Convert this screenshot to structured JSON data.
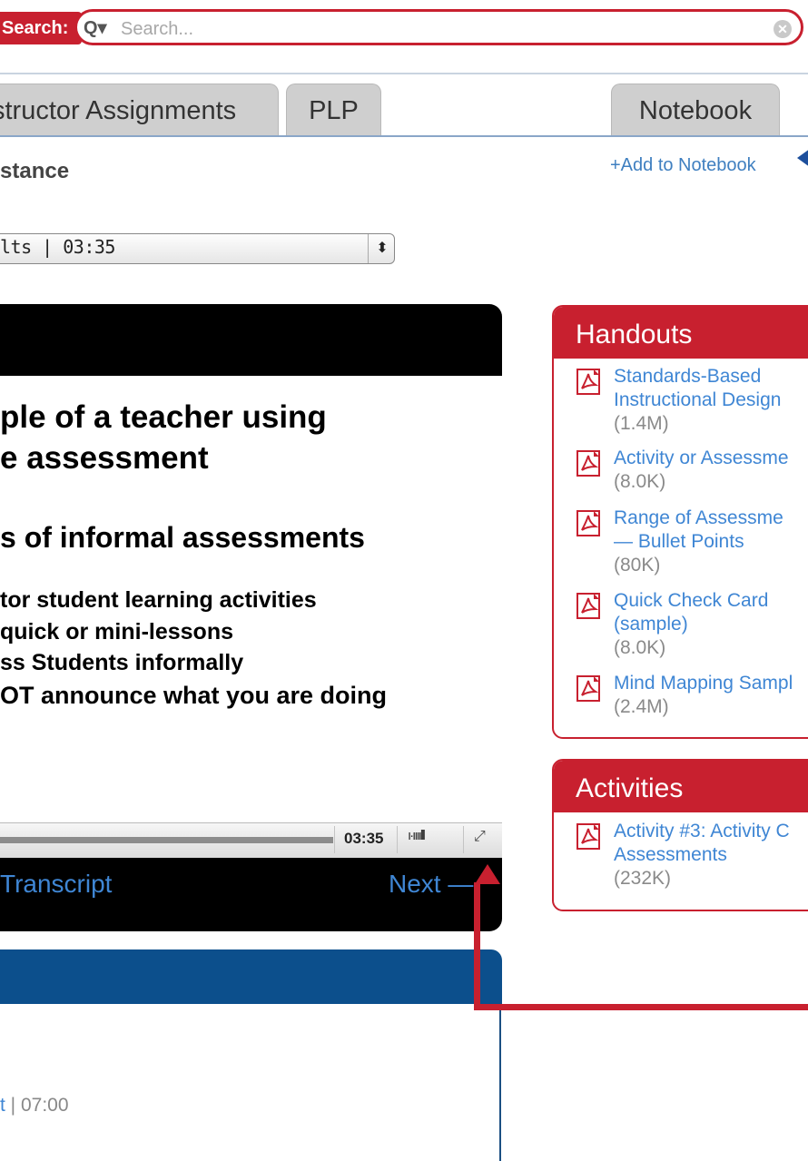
{
  "search": {
    "label": "Search:",
    "placeholder": "Search...",
    "magnifier": "Q▾",
    "clear": "✕"
  },
  "tabs": [
    {
      "label": "structor Assignments"
    },
    {
      "label": "PLP"
    },
    {
      "label": "Notebook"
    }
  ],
  "heading": "stance",
  "add_to_notebook": "+Add to Notebook",
  "video_select": {
    "value": "lts  | 03:35",
    "arrows": "⬍"
  },
  "slide": {
    "lines": [
      "ple of a teacher using",
      "e assessment",
      "s of informal assessments",
      "tor student learning activities",
      "quick or mini-lessons",
      "ss Students informally",
      "OT announce what you are doing"
    ]
  },
  "player": {
    "time": "03:35",
    "volume_glyph": "ı·ıııılll",
    "fullscreen_glyph": "⤢",
    "transcript_label": "Transcript",
    "next_label": "Next —"
  },
  "next_item": {
    "link": "t",
    "duration": " | 07:00"
  },
  "handouts": {
    "title": "Handouts",
    "items": [
      {
        "lines": [
          "Standards-Based",
          "Instructional Design"
        ],
        "size": "(1.4M)"
      },
      {
        "lines": [
          "Activity or Assessme"
        ],
        "size": "(8.0K)"
      },
      {
        "lines": [
          "Range of Assessme",
          "— Bullet Points"
        ],
        "size": "(80K)"
      },
      {
        "lines": [
          "Quick Check Card",
          "(sample)"
        ],
        "size": "(8.0K)"
      },
      {
        "lines": [
          "Mind Mapping Sampl"
        ],
        "size": "(2.4M)"
      }
    ]
  },
  "activities": {
    "title": "Activities",
    "items": [
      {
        "lines": [
          "Activity #3: Activity C",
          "Assessments"
        ],
        "size": "(232K)"
      }
    ]
  },
  "colors": {
    "accent_red": "#c8202f",
    "link_blue": "#3f86d4",
    "panel_blue": "#0c4f8c"
  },
  "icons": [
    "search-icon",
    "clear-icon",
    "select-arrows-icon",
    "volume-icon",
    "fullscreen-icon",
    "pdf-icon",
    "arrow-left-icon",
    "annotation-arrow-icon"
  ]
}
